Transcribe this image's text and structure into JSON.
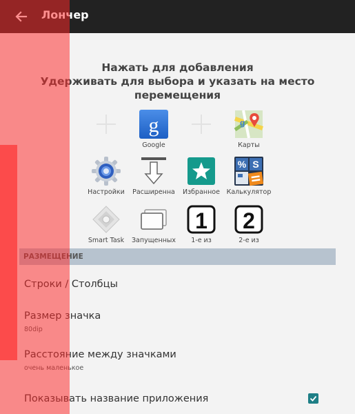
{
  "appbar": {
    "title": "Лончер",
    "back_icon": "arrow-left-icon",
    "background": "#222222"
  },
  "instructions": {
    "line1": "Нажать для добавления",
    "line2": "Удерживать для выбора и указать на место",
    "line3": "перемещения"
  },
  "grid": {
    "row1": [
      {
        "label": "",
        "icon": "plus-icon"
      },
      {
        "label": "Google",
        "icon": "google-icon"
      },
      {
        "label": "",
        "icon": "plus-icon"
      },
      {
        "label": "Карты",
        "icon": "maps-icon"
      }
    ],
    "row2": [
      {
        "label": "Настройки",
        "icon": "settings-gear-icon"
      },
      {
        "label": "Расширенна",
        "icon": "expand-down-icon"
      },
      {
        "label": "Избранное",
        "icon": "favorites-star-icon"
      },
      {
        "label": "Калькулятор",
        "icon": "calculator-icon"
      }
    ],
    "row3": [
      {
        "label": "Smart Task",
        "icon": "smart-task-icon"
      },
      {
        "label": "Запущенных",
        "icon": "running-apps-icon"
      },
      {
        "label": "1-е из",
        "icon": "number-one-icon"
      },
      {
        "label": "2-е из",
        "icon": "number-two-icon"
      }
    ]
  },
  "section": {
    "title": "РАЗМЕЩЕНИЕ"
  },
  "prefs": {
    "rows_cols": "Строки / Столбцы",
    "icon_size": "Размер значка",
    "icon_size_value": "80dip",
    "spacing": "Расстояние между значками",
    "spacing_value": "очень маленькое",
    "show_name": "Показывать название приложения",
    "show_name_checked": true
  },
  "colors": {
    "accent": "#1e7f86",
    "section_bg": "#b7c3cf",
    "overlay": "#ff2828"
  }
}
